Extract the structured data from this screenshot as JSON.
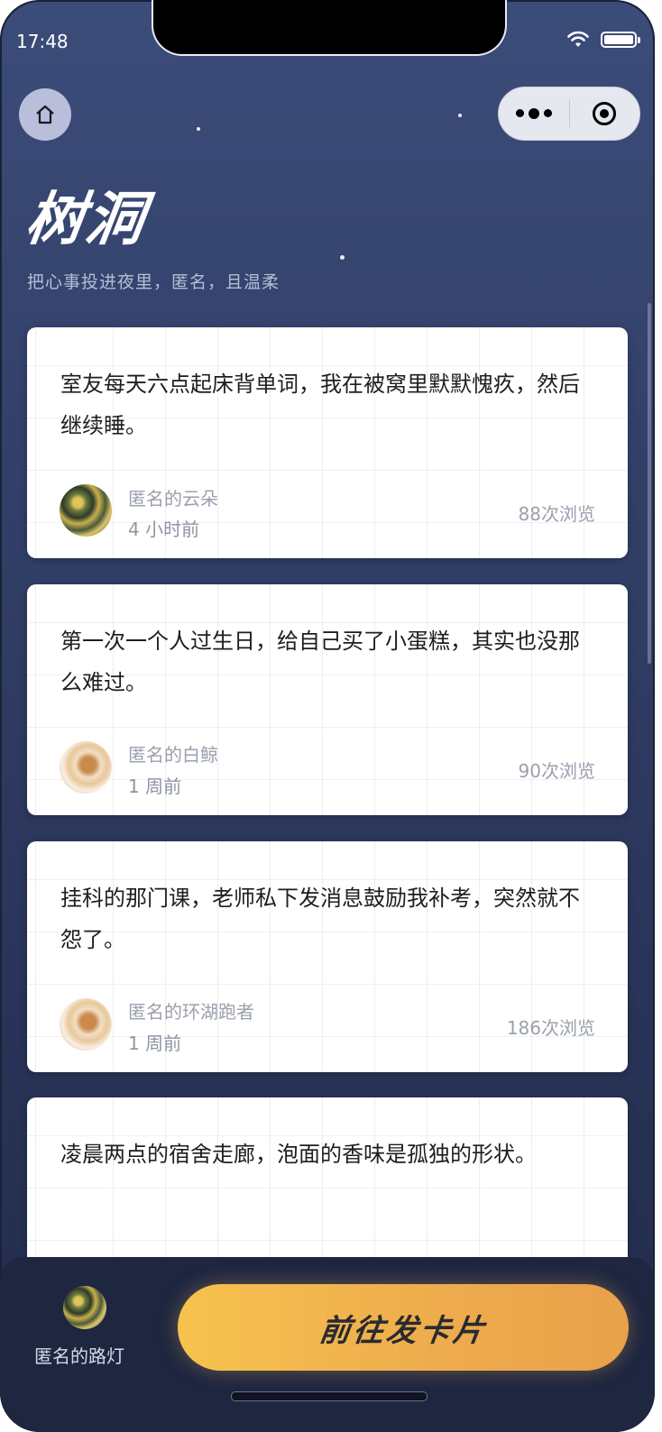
{
  "status_bar": {
    "time": "17:48"
  },
  "header": {
    "title": "树洞",
    "subtitle": "把心事投进夜里，匿名，且温柔"
  },
  "posts": [
    {
      "text": "室友每天六点起床背单词，我在被窝里默默愧疚，然后继续睡。",
      "author": "匿名的云朵",
      "time": "4 小时前",
      "views": "88次浏览",
      "avatar": "leaf-avatar"
    },
    {
      "text": "第一次一个人过生日，给自己买了小蛋糕，其实也没那么难过。",
      "author": "匿名的白鲸",
      "time": "1 周前",
      "views": "90次浏览",
      "avatar": "dog-avatar"
    },
    {
      "text": "挂科的那门课，老师私下发消息鼓励我补考，突然就不怨了。",
      "author": "匿名的环湖跑者",
      "time": "1 周前",
      "views": "186次浏览",
      "avatar": "dog-avatar"
    },
    {
      "text": "凌晨两点的宿舍走廊，泡面的香味是孤独的形状。",
      "author": "",
      "time": "",
      "views": "",
      "avatar": ""
    }
  ],
  "bottom_bar": {
    "user_name": "匿名的路灯",
    "action_label": "前往发卡片"
  },
  "colors": {
    "background_top": "#3c4c79",
    "background_bottom": "#222b4b",
    "button_gradient_start": "#f6c24e",
    "button_gradient_end": "#e8a14a",
    "moon": "#f5e6c8"
  },
  "icons": [
    "home-icon",
    "more-icon",
    "target-icon",
    "wifi-icon",
    "battery-icon",
    "moon-icon"
  ]
}
